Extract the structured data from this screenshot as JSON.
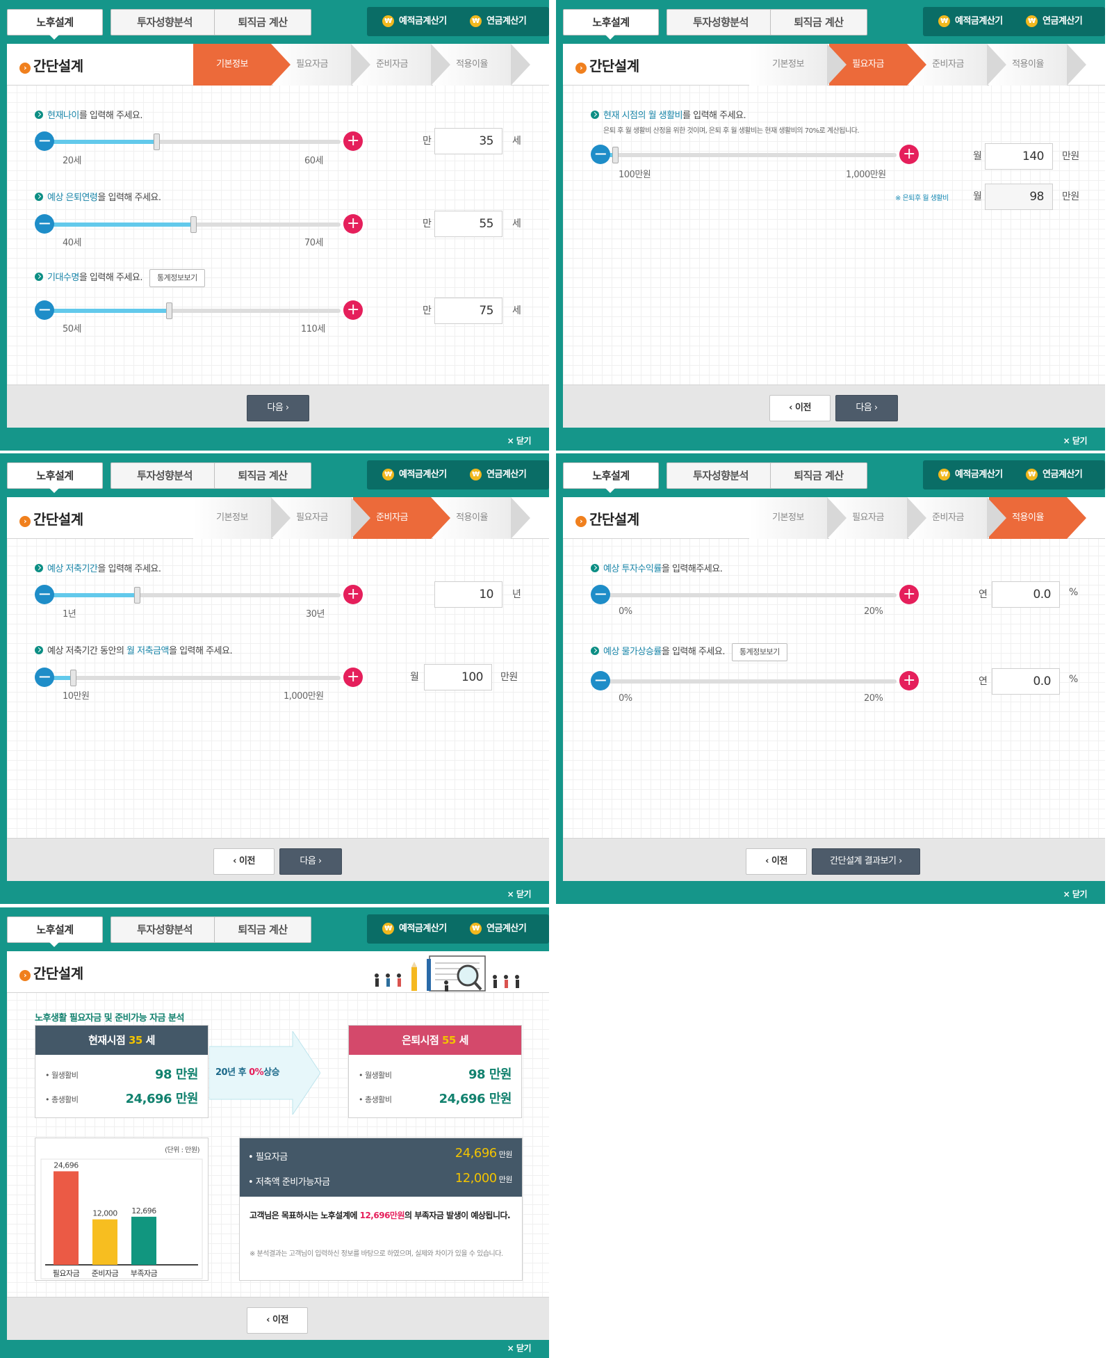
{
  "tabs": {
    "t1": "노후설계",
    "t2": "투자성향분석",
    "t3": "퇴직금 계산"
  },
  "calc": {
    "c1": "예적금계산기",
    "c2": "연금계산기",
    "icon": "₩"
  },
  "title": "간단설계",
  "steps": {
    "s1": "기본정보",
    "s2": "필요자금",
    "s3": "준비자금",
    "s4": "적용이율"
  },
  "close": "× 닫기",
  "buttons": {
    "next": "다음",
    "prev": "이전",
    "result": "간단설계 결과보기"
  },
  "p1": {
    "q1_hl": "현재나이",
    "q1_rest": "를 입력해 주세요.",
    "q1": {
      "min": "20세",
      "max": "60세",
      "prefix": "만",
      "value": "35",
      "unit": "세",
      "level": 0.375
    },
    "q2_hl": "예상 은퇴연령",
    "q2_rest": "을 입력해 주세요.",
    "q2": {
      "min": "40세",
      "max": "70세",
      "prefix": "만",
      "value": "55",
      "unit": "세",
      "level": 0.5
    },
    "q3_hl": "기대수명",
    "q3_rest": "을 입력해 주세요.",
    "stat": "통계정보보기",
    "q3": {
      "min": "50세",
      "max": "110세",
      "prefix": "만",
      "value": "75",
      "unit": "세",
      "level": 0.4167
    }
  },
  "p2": {
    "q1_hl": "현재 시점의 월 생활비",
    "q1_rest": "를 입력해 주세요.",
    "q1_sub": "은퇴 후 월 생활비 산정을 위한 것이며, 은퇴 후 월 생활비는 현재 생활비의 70%로 계산됩니다.",
    "min": "100만원",
    "max": "1,000만원",
    "prefix": "월",
    "value": "140",
    "unit": "만원",
    "level": 0.0444,
    "note": "※ 은퇴후 월 생활비",
    "prefix2": "월",
    "value2": "98",
    "unit2": "만원"
  },
  "p3": {
    "q1_hl": "예상 저축기간",
    "q1_rest": "을 입력해 주세요.",
    "q1": {
      "min": "1년",
      "max": "30년",
      "value": "10",
      "unit": "년",
      "level": 0.31
    },
    "q2_pre": "예상 저축기간 동안의 ",
    "q2_hl": "월 저축금액",
    "q2_rest": "을 입력해 주세요.",
    "q2": {
      "min": "10만원",
      "max": "1,000만원",
      "prefix": "월",
      "value": "100",
      "unit": "만원",
      "level": 0.0909
    }
  },
  "p4": {
    "q1_hl": "예상 투자수익률",
    "q1_rest": "을 입력해주세요.",
    "q1": {
      "min": "0%",
      "max": "20%",
      "prefix": "연",
      "value": "0.0",
      "unit": "%",
      "level": 0
    },
    "q2_hl": "예상 물가상승률",
    "q2_rest": "을 입력해 주세요.",
    "stat": "통계정보보기",
    "q2": {
      "min": "0%",
      "max": "20%",
      "prefix": "연",
      "value": "0.0",
      "unit": "%",
      "level": 0
    }
  },
  "p5": {
    "subtitle": "노후생활 필요자금 및 준비가능 자금 분석",
    "now_label": "현재시점",
    "now_age": "35",
    "age_unit": "세",
    "ret_label": "은퇴시점",
    "ret_age": "55",
    "monthly_label": "월생활비",
    "total_label": "총생활비",
    "now_monthly": "98",
    "now_total": "24,696",
    "man": "만원",
    "ret_monthly": "98",
    "ret_total": "24,696",
    "arrow_years": "20년 후",
    "arrow_pct": "0%",
    "arrow_rise": "상승",
    "chart_unit": "(단위 : 만원)",
    "need_label": "필요자금",
    "need_value": "24,696",
    "need_unit": "만원",
    "prep_label": "저축액 준비가능자금",
    "prep_value": "12,000",
    "prep_unit": "만원",
    "msg_pre": "고객님은 목표하시는 노후설계에 ",
    "msg_hl": "12,696만원",
    "msg_post": "의 부족자금 발생이 예상됩니다.",
    "disclaimer": "※ 분석결과는 고객님이 입력하신 정보를 바탕으로 하였으며, 실제와 차이가 있을 수 있습니다."
  },
  "colors": {
    "teal": "#15968a",
    "orange": "#ec6a3a",
    "navy": "#445868",
    "pink": "#d4496b"
  },
  "chart_data": {
    "type": "bar",
    "categories": [
      "필요자금",
      "준비자금",
      "부족자금"
    ],
    "values": [
      24696,
      12000,
      12696
    ],
    "value_labels": [
      "24,696",
      "12,000",
      "12,696"
    ],
    "colors": [
      "#eb5a45",
      "#f7be20",
      "#11967f"
    ],
    "unit": "(단위 : 만원)",
    "ylim": [
      0,
      30000
    ]
  }
}
